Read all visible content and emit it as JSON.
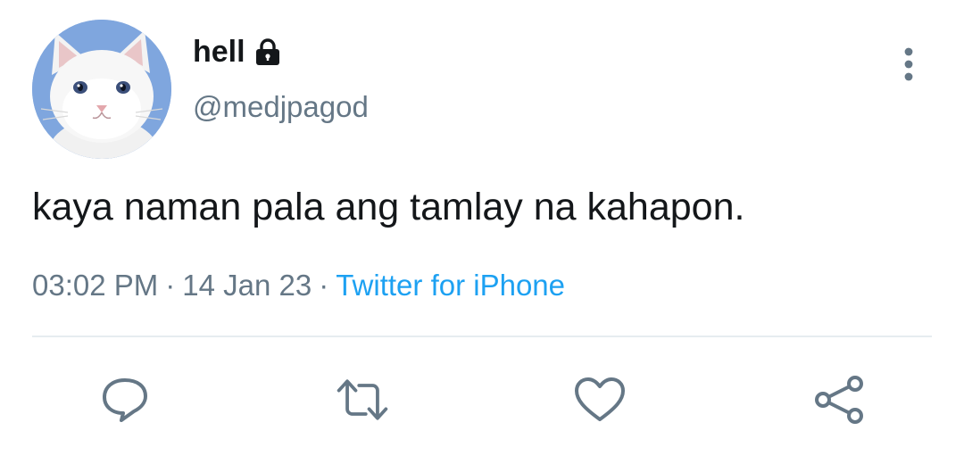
{
  "author": {
    "display_name": "hell",
    "handle": "@medjpagod",
    "protected_icon": "lock-icon",
    "avatar": "white-cat-avatar"
  },
  "tweet": {
    "text": "kaya naman pala ang tamlay na kahapon.",
    "time": "03:02 PM",
    "date": "14 Jan 23",
    "separator": "·",
    "source": "Twitter for iPhone"
  },
  "actions": [
    {
      "name": "reply",
      "icon": "reply-icon"
    },
    {
      "name": "retweet",
      "icon": "retweet-icon"
    },
    {
      "name": "like",
      "icon": "heart-icon"
    },
    {
      "name": "share",
      "icon": "share-icon"
    }
  ],
  "menu_icon": "more-vertical-icon",
  "colors": {
    "text": "#14171a",
    "secondary": "#657786",
    "link": "#1da1f2",
    "divider": "#e6ecf0",
    "avatar_bg": "#7fa6de"
  }
}
